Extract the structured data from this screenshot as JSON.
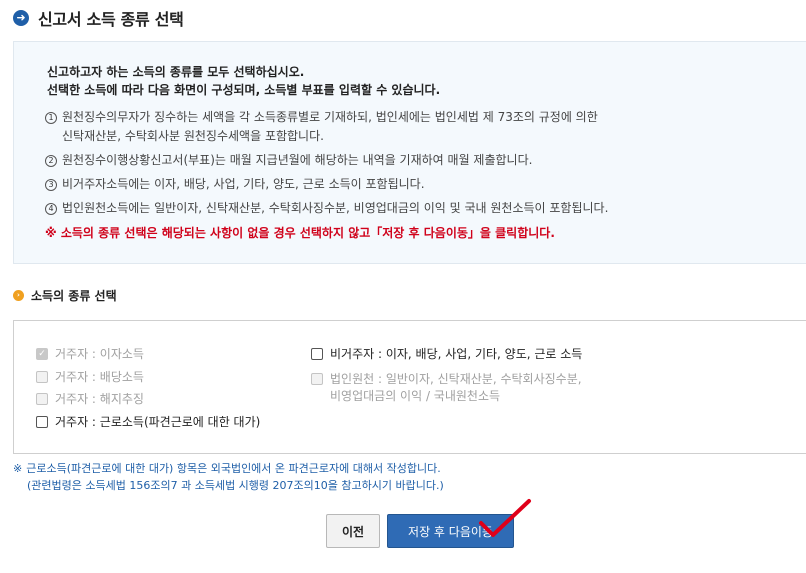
{
  "header": {
    "title": "신고서 소득 종류 선택",
    "icon": "arrow-circle-icon"
  },
  "notice": {
    "line1": "신고하고자 하는 소득의 종류를 모두 선택하십시오.",
    "line2": "선택한 소득에 따라 다음 화면이 구성되며, 소득별 부표를 입력할 수 있습니다.",
    "items": [
      {
        "num": "1",
        "text": "원천징수의무자가 징수하는 세액을 각 소득종류별로 기재하되, 법인세에는 법인세법 제 73조의 규정에 의한\n신탁재산분, 수탁회사분 원천징수세액을 포함합니다."
      },
      {
        "num": "2",
        "text": "원천징수이행상황신고서(부표)는 매월 지급년월에 해당하는 내역을 기재하여 매월 제출합니다."
      },
      {
        "num": "3",
        "text": "비거주자소득에는 이자, 배당, 사업, 기타, 양도, 근로 소득이 포함됩니다."
      },
      {
        "num": "4",
        "text": "법인원천소득에는 일반이자, 신탁재산분, 수탁회사징수분, 비영업대금의 이익 및 국내 원천소득이 포함됩니다."
      }
    ],
    "warning": "※ 소득의 종류 선택은 해당되는 사항이 없을 경우 선택하지 않고「저장 후 다음이동」을 클릭합니다."
  },
  "section": {
    "title": "소득의 종류 선택",
    "icon": "chevron-circle-icon"
  },
  "options": {
    "interest": {
      "label": "거주자 : 이자소득",
      "checked": true,
      "disabled": true
    },
    "dividend": {
      "label": "거주자 : 배당소득",
      "checked": false,
      "disabled": true
    },
    "retirement": {
      "label": "거주자 : 해지추징",
      "checked": false,
      "disabled": true
    },
    "dispatched_labor": {
      "label": "거주자 : 근로소득(파견근로에 대한 대가)",
      "checked": false,
      "disabled": false
    },
    "nonresident": {
      "label": "비거주자 : 이자, 배당, 사업, 기타, 양도, 근로 소득",
      "checked": false,
      "disabled": false
    },
    "corporate": {
      "label": "법인원천 : 일반이자, 신탁재산분, 수탁회사징수분,\n비영업대금의 이익 / 국내원천소득",
      "checked": false,
      "disabled": true
    }
  },
  "footnote": {
    "mark": "※",
    "line1": "근로소득(파견근로에 대한 대가) 항목은 외국법인에서 온 파견근로자에 대해서 작성합니다.",
    "line2": "(관련법령은 소득세법 156조의7 과 소득세법 시행령 207조의10을 참고하시기 바랍니다.)"
  },
  "buttons": {
    "prev": "이전",
    "next": "저장 후 다음이동"
  },
  "colors": {
    "accent": "#2f6bb5",
    "warning": "#d0021b",
    "notice_bg": "#f4f9fd",
    "annotation": "#e0001a"
  }
}
